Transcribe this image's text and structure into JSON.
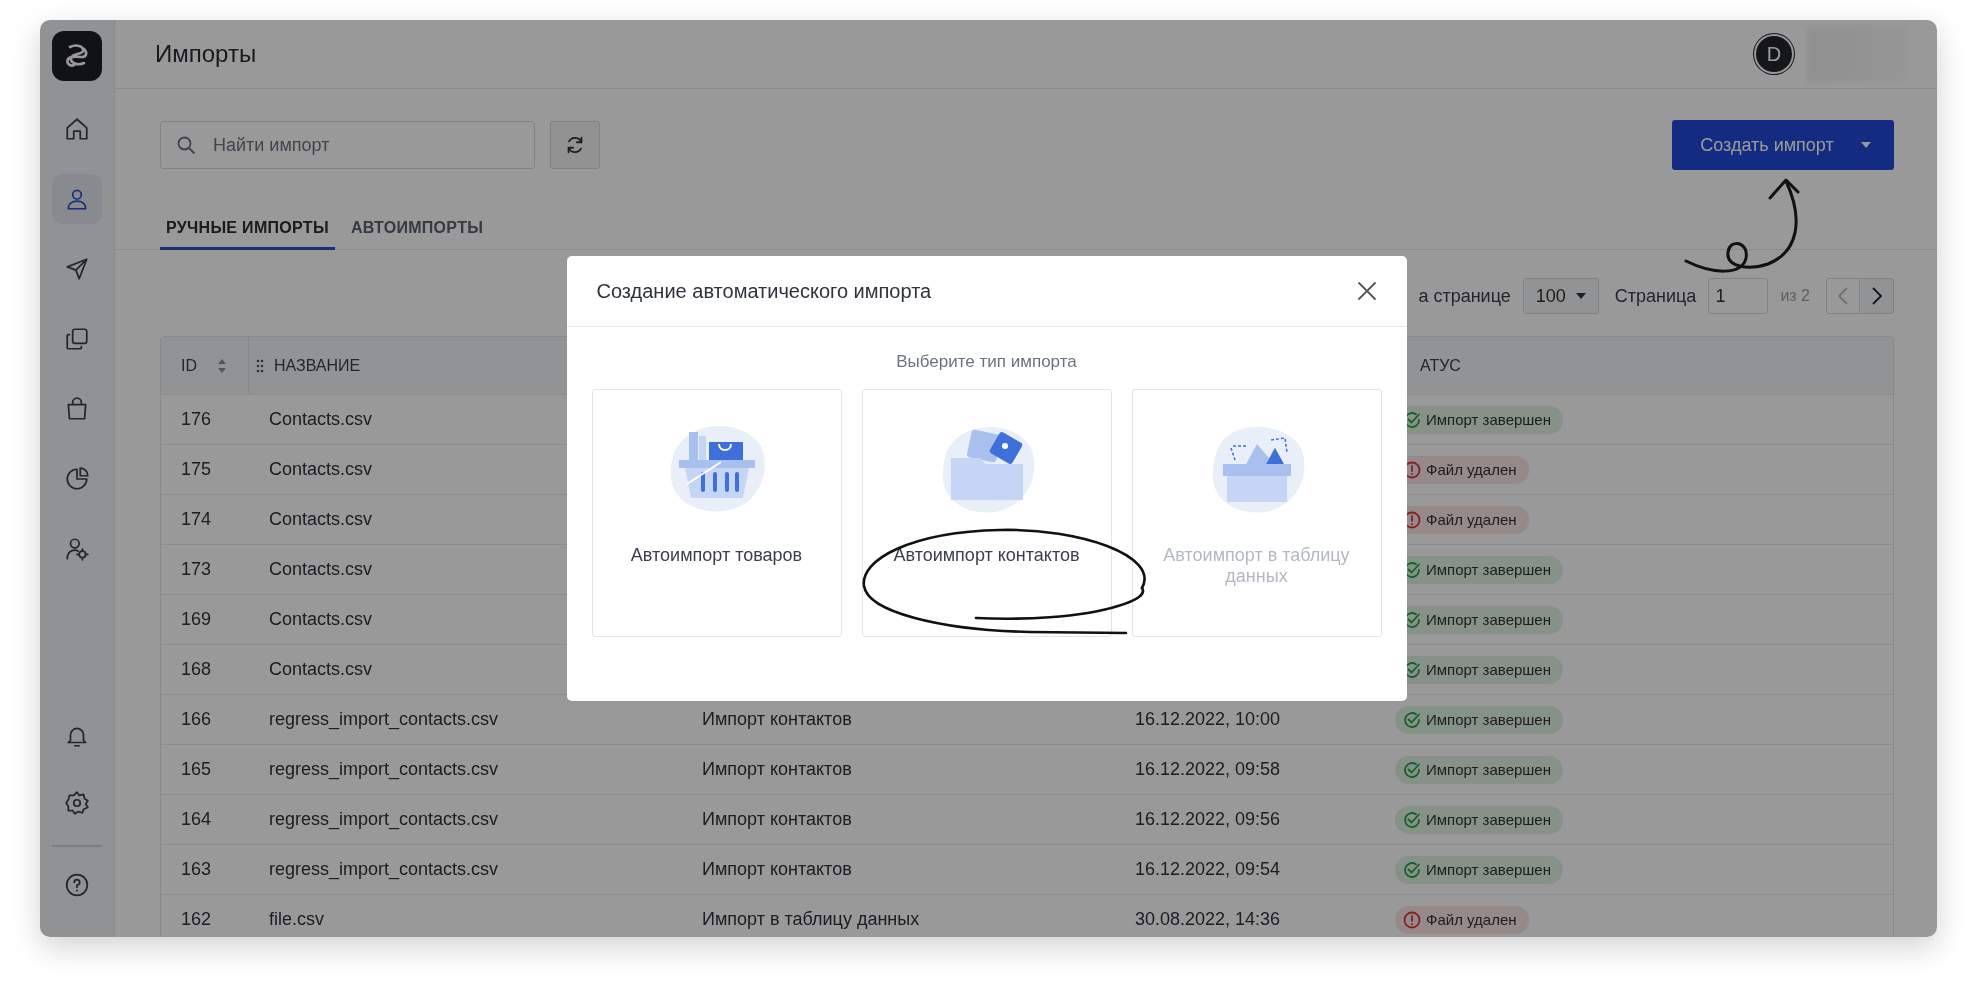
{
  "header": {
    "title": "Импорты",
    "avatar": "D"
  },
  "sidebar": {
    "top_items": [
      {
        "selected": false
      },
      {
        "selected": true
      },
      {
        "selected": false
      },
      {
        "selected": false
      },
      {
        "selected": false
      },
      {
        "selected": false
      },
      {
        "selected": false
      }
    ],
    "bottom_items": [
      {
        "selected": false
      },
      {
        "selected": false
      },
      {
        "selected": false
      }
    ]
  },
  "search": {
    "placeholder": "Найти импорт"
  },
  "create_button": {
    "label": "Создать импорт"
  },
  "tabs": [
    {
      "label": "РУЧНЫЕ ИМПОРТЫ",
      "selected": true
    },
    {
      "label": "АВТОИМПОРТЫ",
      "selected": false
    }
  ],
  "pagination": {
    "per_page_label": "а странице",
    "per_page": "100",
    "page_label": "Страница",
    "page": "1",
    "total": "из 2",
    "prev_disabled": true,
    "next_disabled": false
  },
  "table": {
    "id_column": "ID",
    "name_column": "НАЗВАНИЕ",
    "status_column": "АТУС",
    "rows": [
      {
        "id": "176",
        "name": "Contacts.csv",
        "status": {
          "text": "Импорт завершен",
          "kind": "done"
        }
      },
      {
        "id": "175",
        "name": "Contacts.csv",
        "status": {
          "text": "Файл удален",
          "kind": "deleted"
        }
      },
      {
        "id": "174",
        "name": "Contacts.csv",
        "status": {
          "text": "Файл удален",
          "kind": "deleted"
        }
      },
      {
        "id": "173",
        "name": "Contacts.csv",
        "status": {
          "text": "Импорт завершен",
          "kind": "done"
        }
      },
      {
        "id": "169",
        "name": "Contacts.csv",
        "status": {
          "text": "Импорт завершен",
          "kind": "done"
        }
      },
      {
        "id": "168",
        "name": "Contacts.csv",
        "status": {
          "text": "Импорт завершен",
          "kind": "done"
        }
      },
      {
        "id": "166",
        "name": "regress_import_contacts.csv",
        "type": "Импорт контактов",
        "date": "16.12.2022, 10:00",
        "status": {
          "text": "Импорт завершен",
          "kind": "done"
        }
      },
      {
        "id": "165",
        "name": "regress_import_contacts.csv",
        "type": "Импорт контактов",
        "date": "16.12.2022, 09:58",
        "status": {
          "text": "Импорт завершен",
          "kind": "done"
        }
      },
      {
        "id": "164",
        "name": "regress_import_contacts.csv",
        "type": "Импорт контактов",
        "date": "16.12.2022, 09:56",
        "status": {
          "text": "Импорт завершен",
          "kind": "done"
        }
      },
      {
        "id": "163",
        "name": "regress_import_contacts.csv",
        "type": "Импорт контактов",
        "date": "16.12.2022, 09:54",
        "status": {
          "text": "Импорт завершен",
          "kind": "done"
        }
      },
      {
        "id": "162",
        "name": "file.csv",
        "type": "Импорт в таблицу данных",
        "date": "30.08.2022, 14:36",
        "status": {
          "text": "Файл удален",
          "kind": "deleted"
        }
      }
    ]
  },
  "modal": {
    "title": "Создание автоматического импорта",
    "subtitle": "Выберите тип импорта",
    "options": [
      {
        "label": "Автоимпорт товаров",
        "kind": "basket",
        "disabled": false
      },
      {
        "label": "Автоимпорт контактов",
        "kind": "folder",
        "disabled": false
      },
      {
        "label": "Автоимпорт в таблицу данных",
        "kind": "box",
        "disabled": true
      }
    ]
  }
}
